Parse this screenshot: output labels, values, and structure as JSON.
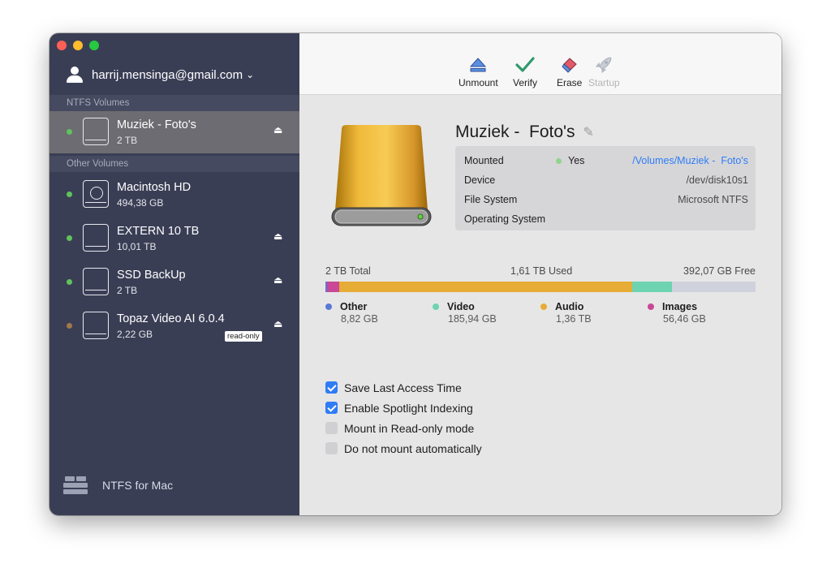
{
  "sidebar": {
    "account": "harrij.mensinga@gmail.com",
    "ntfs_section": "NTFS Volumes",
    "other_section": "Other Volumes",
    "ntfs_volumes": [
      {
        "name": "Muziek -  Foto's",
        "size": "2 TB",
        "status_color": "#5fc35c"
      }
    ],
    "other_volumes": [
      {
        "name": "Macintosh HD",
        "size": "494,38 GB",
        "status_color": "#5fc35c"
      },
      {
        "name": "EXTERN 10 TB",
        "size": "10,01 TB",
        "status_color": "#5fc35c"
      },
      {
        "name": "SSD BackUp",
        "size": "2 TB",
        "status_color": "#5fc35c"
      },
      {
        "name": "Topaz Video AI 6.0.4",
        "size": "2,22 GB",
        "badge": "read-only",
        "status_color": "#a0784a"
      }
    ],
    "brand": "NTFS for Mac"
  },
  "toolbar": {
    "unmount": "Unmount",
    "verify": "Verify",
    "erase": "Erase",
    "startup": "Startup"
  },
  "volume": {
    "title": "Muziek -  Foto's",
    "mounted_label": "Mounted",
    "mounted_value": "Yes",
    "mount_path": "/Volumes/Muziek -  Foto's",
    "device_label": "Device",
    "device_value": "/dev/disk10s1",
    "fs_label": "File System",
    "fs_value": "Microsoft NTFS",
    "os_label": "Operating System",
    "os_value": ""
  },
  "usage": {
    "total": "2 TB Total",
    "used": "1,61 TB Used",
    "free": "392,07 GB Free",
    "segments": [
      {
        "name": "Other",
        "value": "8,82 GB",
        "color": "#5a78d6",
        "fraction": 0.0044
      },
      {
        "name": "Images",
        "value": "56,46 GB",
        "color": "#c94796",
        "fraction": 0.0282
      },
      {
        "name": "Audio",
        "value": "1,36 TB",
        "color": "#e6ac35",
        "fraction": 0.68
      },
      {
        "name": "Video",
        "value": "185,94 GB",
        "color": "#6dd3b1",
        "fraction": 0.093
      }
    ]
  },
  "options": [
    {
      "label": "Save Last Access Time",
      "checked": true
    },
    {
      "label": "Enable Spotlight Indexing",
      "checked": true
    },
    {
      "label": "Mount in Read-only mode",
      "checked": false
    },
    {
      "label": "Do not mount automatically",
      "checked": false
    }
  ]
}
